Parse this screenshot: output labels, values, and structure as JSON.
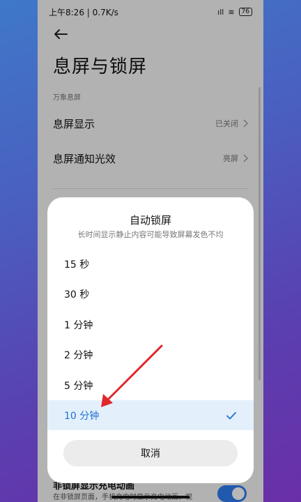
{
  "status_bar": {
    "time": "上午8:26 | 0.7K/s",
    "signal": "ıll",
    "wifi": "≋",
    "battery": "76"
  },
  "page": {
    "title": "息屏与锁屏",
    "section_label": "万象息屏"
  },
  "settings": [
    {
      "label": "息屏显示",
      "value": "已关闭"
    },
    {
      "label": "息屏通知光效",
      "value": "亮屏"
    }
  ],
  "bottom_item": {
    "title": "非锁屏显示充电动画",
    "description": "在非锁屏页面，手机充电时显示充电动画，视"
  },
  "dialog": {
    "title": "自动锁屏",
    "subtitle": "长时间显示静止内容可能导致屏幕发色不均",
    "options": [
      {
        "label": "15 秒",
        "selected": false
      },
      {
        "label": "30 秒",
        "selected": false
      },
      {
        "label": "1 分钟",
        "selected": false
      },
      {
        "label": "2 分钟",
        "selected": false
      },
      {
        "label": "5 分钟",
        "selected": false
      },
      {
        "label": "10 分钟",
        "selected": true
      }
    ],
    "cancel_label": "取消"
  },
  "colors": {
    "accent": "#1f6fd1",
    "selected_bg": "#e3f0fc",
    "annotation_arrow": "#e0272b",
    "toggle_on": "#2f7cf0"
  },
  "icons": {
    "back": "arrow-left-icon",
    "row_chevron": "chevron-right-icon",
    "selected_mark": "checkmark-icon"
  }
}
